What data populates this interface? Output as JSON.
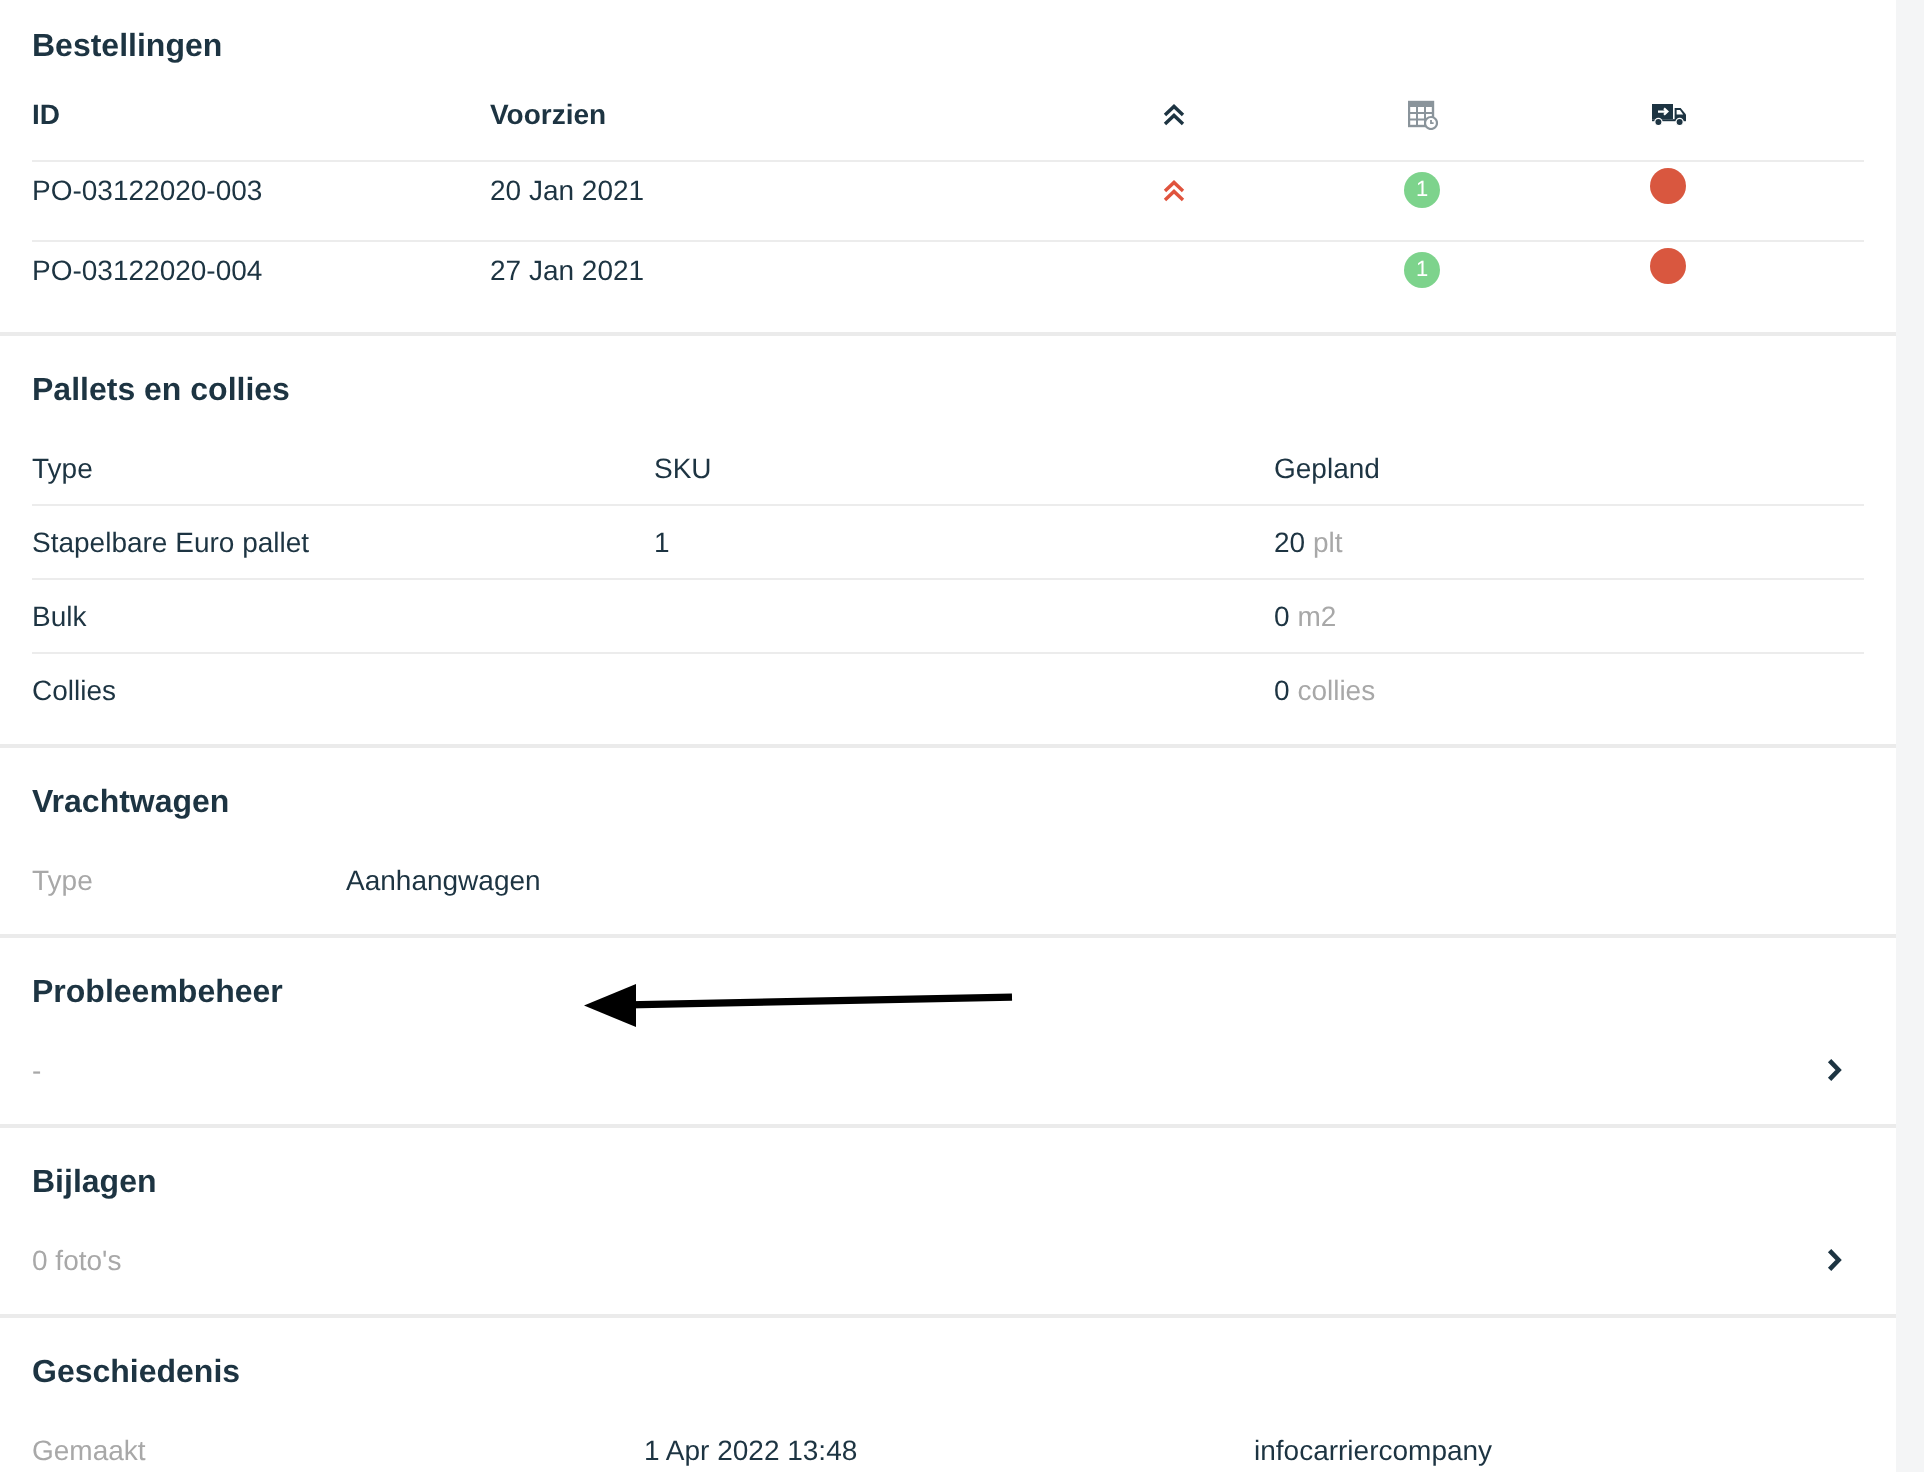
{
  "orders": {
    "title": "Bestellingen",
    "columns": [
      "ID",
      "Voorzien"
    ],
    "rows": [
      {
        "id": "PO-03122020-003",
        "expected": "20 Jan 2021",
        "priority": true,
        "planned_count": "1",
        "color": "#d9573f"
      },
      {
        "id": "PO-03122020-004",
        "expected": "27 Jan 2021",
        "priority": false,
        "planned_count": "1",
        "color": "#d9573f"
      }
    ]
  },
  "pallets": {
    "title": "Pallets en collies",
    "columns": [
      "Type",
      "SKU",
      "Gepland"
    ],
    "rows": [
      {
        "type": "Stapelbare Euro pallet",
        "sku": "1",
        "planned": "20",
        "unit": "plt"
      },
      {
        "type": "Bulk",
        "planned": "0",
        "unit": "m2"
      },
      {
        "type": "Collies",
        "planned": "0",
        "unit": "collies"
      }
    ]
  },
  "truck": {
    "title": "Vrachtwagen",
    "fields": [
      {
        "label": "Type",
        "value": "Aanhangwagen"
      }
    ]
  },
  "problems": {
    "title": "Probleembeheer",
    "value": "-"
  },
  "attachments": {
    "title": "Bijlagen",
    "value": "0 foto's"
  },
  "history": {
    "title": "Geschiedenis",
    "entries": [
      {
        "action": "Gemaakt",
        "time": "1 Apr 2022 13:48",
        "user": "infocarriercompany"
      }
    ]
  }
}
